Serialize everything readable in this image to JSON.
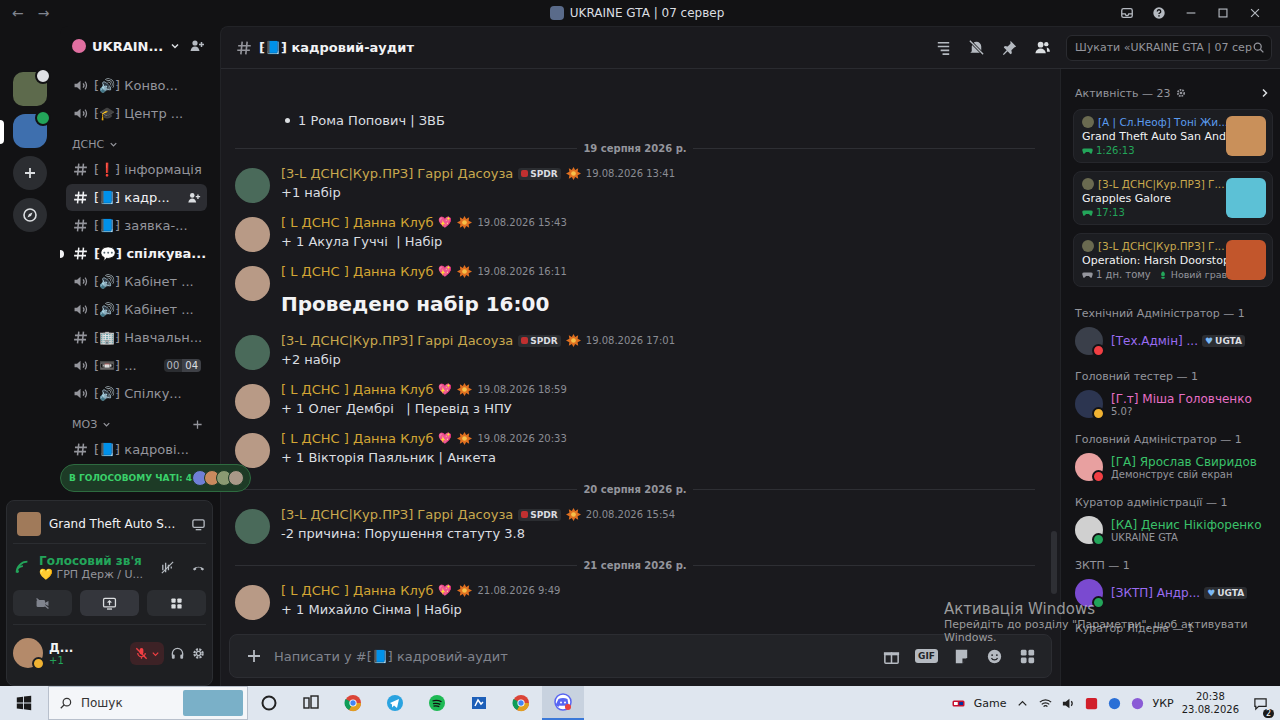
{
  "window": {
    "title": "UKRAINE GTA | 07 сервер",
    "nav": [
      "←",
      "→"
    ]
  },
  "servers": [
    {
      "kind": "image",
      "selected": false,
      "color": "#5d6a4c",
      "badge_color": "#dfe1e5"
    },
    {
      "kind": "image",
      "selected": true,
      "color": "#3e6fae",
      "badge_color": "#23a55a"
    },
    {
      "kind": "add",
      "selected": false,
      "color": "#2b2d31",
      "badge_color": ""
    },
    {
      "kind": "explore",
      "selected": false,
      "color": "#2b2d31",
      "badge_color": ""
    }
  ],
  "server": {
    "name": "UKRAIN..."
  },
  "channel_groups": [
    {
      "category": "",
      "expanded": true,
      "channels": [
        {
          "kind": "voice",
          "label": "⁅🔊⁆ Конво...",
          "selected": false,
          "unread": false,
          "limit": []
        },
        {
          "kind": "voice",
          "label": "⁅🎓⁆ Центр ...",
          "selected": false,
          "unread": false,
          "limit": []
        }
      ]
    },
    {
      "category": "ДСНС",
      "expanded": true,
      "channels": [
        {
          "kind": "text",
          "label": "⁅❗⁆ інформація",
          "selected": false,
          "unread": false,
          "limit": []
        },
        {
          "kind": "text",
          "label": "⁅📘⁆ кадр...",
          "selected": true,
          "unread": false,
          "limit": []
        },
        {
          "kind": "text",
          "label": "⁅📘⁆ заявка-...",
          "selected": false,
          "unread": false,
          "limit": []
        },
        {
          "kind": "text",
          "label": "⁅💬⁆ спілкува...",
          "selected": false,
          "unread": true,
          "limit": []
        },
        {
          "kind": "voice",
          "label": "⁅🔊⁆ Кабінет ...",
          "selected": false,
          "unread": false,
          "limit": []
        },
        {
          "kind": "voice",
          "label": "⁅🔊⁆ Кабінет ...",
          "selected": false,
          "unread": false,
          "limit": []
        },
        {
          "kind": "text",
          "label": "⁅🏢⁆ Навчальн...",
          "selected": false,
          "unread": false,
          "limit": []
        },
        {
          "kind": "voice",
          "label": "⁅📼⁆ ...",
          "selected": false,
          "unread": false,
          "limit": [
            "00",
            "04"
          ]
        },
        {
          "kind": "voice",
          "label": "⁅🔊⁆ Спілку...",
          "selected": false,
          "unread": false,
          "limit": []
        }
      ]
    },
    {
      "category": "МОЗ",
      "expanded": true,
      "channels": [
        {
          "kind": "text",
          "label": "⁅📘⁆ кадрові...",
          "selected": false,
          "unread": false,
          "limit": []
        }
      ]
    }
  ],
  "voice_pill": {
    "label": "В ГОЛОСОВОМУ ЧАТІ: 4",
    "avatars": [
      "#6f7fd6",
      "#c98a5e",
      "#8a9a72",
      "#a89888"
    ]
  },
  "user_panel": {
    "activity": "Grand Theft Auto S...",
    "voice": {
      "status": "Голосовий зв'я",
      "channel": "💛 ГРП Держ / U..."
    },
    "controls": [
      {
        "kind": "camera",
        "selected": false
      },
      {
        "kind": "screen",
        "selected": true
      },
      {
        "kind": "activities",
        "selected": false
      }
    ],
    "user": {
      "name": "Д...",
      "status": "+1",
      "mic_muted": true,
      "avatar_color": "#b48a6a"
    }
  },
  "chat": {
    "channel": "⁅📘⁆ кадровий-аудит",
    "search_placeholder": "Шукати «UKRAINE GTA | 07 сер",
    "input_placeholder": "Написати у #⁅📘⁆ кадровий-аудит",
    "gif_label": "GIF",
    "scrollbar": {
      "level": 0.12
    }
  },
  "messages": [
    {
      "kind": "bullet",
      "text": "1 Рома Попович | ЗВБ"
    },
    {
      "kind": "divider",
      "text": "19 серпня 2026 р."
    },
    {
      "kind": "message",
      "author": "[3-L ДСНС|Кур.ПРЗ] Гаррі Дасоуза",
      "author_color": "#c9a94e",
      "avatar_color": "#4a6a5a",
      "tag": "SPDR",
      "emoji": "",
      "time": "19.08.2026 13:41",
      "text": "+1 набір",
      "big": false
    },
    {
      "kind": "message",
      "author": "[ L  ДСНС ] Данна Клуб",
      "author_color": "#d4a634",
      "avatar_color": "#b89a86",
      "tag": "",
      "emoji": "💖",
      "time": "19.08.2026 15:43",
      "text": "+ 1 Акула Гуччі  | Набір",
      "big": false
    },
    {
      "kind": "message",
      "author": "[ L  ДСНС ] Данна Клуб",
      "author_color": "#d4a634",
      "avatar_color": "#b89a86",
      "tag": "",
      "emoji": "💖",
      "time": "19.08.2026 16:11",
      "text": "Проведено набір 16:00",
      "big": true
    },
    {
      "kind": "message",
      "author": "[3-L ДСНС|Кур.ПРЗ] Гаррі Дасоуза",
      "author_color": "#c9a94e",
      "avatar_color": "#4a6a5a",
      "tag": "SPDR",
      "emoji": "",
      "time": "19.08.2026 17:01",
      "text": "+2 набір",
      "big": false
    },
    {
      "kind": "message",
      "author": "[ L  ДСНС ] Данна Клуб",
      "author_color": "#d4a634",
      "avatar_color": "#b89a86",
      "tag": "",
      "emoji": "💖",
      "time": "19.08.2026 18:59",
      "text": "+ 1 Олег Дембрі   | Перевід з НПУ",
      "big": false
    },
    {
      "kind": "message",
      "author": "[ L  ДСНС ] Данна Клуб",
      "author_color": "#d4a634",
      "avatar_color": "#b89a86",
      "tag": "",
      "emoji": "💖",
      "time": "19.08.2026 20:33",
      "text": "+ 1 Вікторія Паяльник | Анкета",
      "big": false
    },
    {
      "kind": "divider",
      "text": "20 серпня 2026 р."
    },
    {
      "kind": "message",
      "author": "[3-L ДСНС|Кур.ПРЗ] Гаррі Дасоуза",
      "author_color": "#c9a94e",
      "avatar_color": "#4a6a5a",
      "tag": "SPDR",
      "emoji": "",
      "time": "20.08.2026 15:54",
      "text": "-2 причина: Порушення статуту 3.8",
      "big": false
    },
    {
      "kind": "divider",
      "text": "21 серпня 2026 р."
    },
    {
      "kind": "message",
      "author": "[ L  ДСНС ] Данна Клуб",
      "author_color": "#d4a634",
      "avatar_color": "#b89a86",
      "tag": "",
      "emoji": "💖",
      "time": "21.08.2026 9:49",
      "text": "+ 1 Михайло Сінма | Набір",
      "big": false
    }
  ],
  "members": {
    "activity_header": "Активність — 23",
    "activities": [
      {
        "name": "[A | Сл.Неоф] Тоні Жи...",
        "name_color": "#5b9cf0",
        "game": "Grand Theft Auto San Andr...",
        "detail": "1:26:13",
        "extra": "",
        "live": true,
        "art_color": "#c9905a"
      },
      {
        "name": "[3-L ДСНС|Кур.ПРЗ] Г...",
        "name_color": "#c9a94e",
        "game": "Grapples Galore",
        "detail": "17:13",
        "extra": "",
        "live": true,
        "art_color": "#5cc1d6"
      },
      {
        "name": "[3-L ДСНС|Кур.ПРЗ] Г...",
        "name_color": "#c9a94e",
        "game": "Operation: Harsh Doorstop",
        "detail": "1 дн. тому",
        "extra": "Новий гравець",
        "live": false,
        "art_color": "#c2562c"
      }
    ],
    "roles": [
      {
        "title": "Технічний Адміністратор — 1",
        "members": [
          {
            "name": "[Тех.Адмін] ...",
            "color": "#9a6cf2",
            "status": "",
            "badge": "UGTA",
            "presence_color": "#f23f43",
            "avatar_color": "#3a3f4a"
          }
        ]
      },
      {
        "title": "Головний тестер — 1",
        "members": [
          {
            "name": "[Г.т] Міша Головченко",
            "color": "#e86fc6",
            "status": "5.0?",
            "badge": "",
            "presence_color": "#f0b232",
            "avatar_color": "#2c3550"
          }
        ]
      },
      {
        "title": "Головний Адміністратор — 1",
        "members": [
          {
            "name": "[ГА] Ярослав Свиридов",
            "color": "#3ac26a",
            "status": "Демонструє свій екран",
            "badge": "",
            "presence_color": "#f23f43",
            "avatar_color": "#e8a0a0"
          }
        ]
      },
      {
        "title": "Куратор адміністрації — 1",
        "members": [
          {
            "name": "[КА] Денис Нікіфоренко",
            "color": "#3ac26a",
            "status": "UKRAINE GTA",
            "badge": "",
            "presence_color": "#23a55a",
            "avatar_color": "#d0d0d0"
          }
        ]
      },
      {
        "title": "ЗКТП — 1",
        "members": [
          {
            "name": "[ЗКТП] Андр...",
            "color": "#9a6cf2",
            "status": "",
            "badge": "UGTA",
            "presence_color": "#23a55a",
            "avatar_color": "#7a4ad0"
          }
        ]
      },
      {
        "title": "Куратор Лідерів — 1",
        "members": []
      }
    ]
  },
  "taskbar": {
    "search": "Пошук",
    "apps": [
      {
        "kind": "circle",
        "color": "#222222",
        "selected": false
      },
      {
        "kind": "taskview",
        "color": "#222222",
        "selected": false
      },
      {
        "kind": "chrome",
        "color": "#e0a020",
        "selected": false
      },
      {
        "kind": "telegram",
        "color": "#2aa3e0",
        "selected": false
      },
      {
        "kind": "spotify",
        "color": "#1db954",
        "selected": false
      },
      {
        "kind": "app",
        "color": "#1d5fb8",
        "selected": false
      },
      {
        "kind": "chrome",
        "color": "#e0a020",
        "selected": false
      },
      {
        "kind": "discord",
        "color": "#5865f2",
        "selected": true
      }
    ],
    "game": "Game",
    "lang": "УКР",
    "time": "20:38",
    "date": "23.08.2026",
    "notifications": "2"
  },
  "watermark": {
    "title": "Активація Windows",
    "line1": "Перейдіть до розділу \"Параметри\", щоб активувати",
    "line2": "Windows."
  }
}
